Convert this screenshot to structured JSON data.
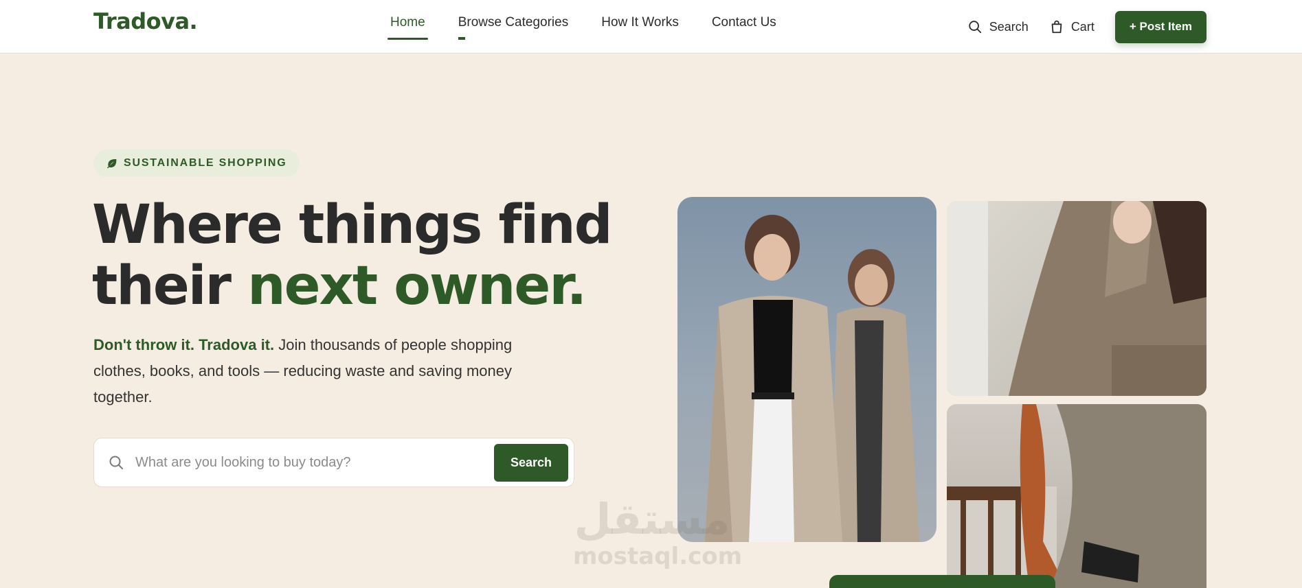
{
  "header": {
    "logo": "Tradova.",
    "nav": [
      {
        "label": "Home",
        "active": true
      },
      {
        "label": "Browse Categories",
        "active": false
      },
      {
        "label": "How It Works",
        "active": false
      },
      {
        "label": "Contact Us",
        "active": false
      }
    ],
    "search_label": "Search",
    "cart_label": "Cart",
    "post_button": "+ Post Item"
  },
  "hero": {
    "badge": "SUSTAINABLE SHOPPING",
    "headline_line1": "Where things find",
    "headline_line2_plain": "their ",
    "headline_line2_accent": "next owner.",
    "subtext_strong": "Don't throw it. Tradova it.",
    "subtext_rest": " Join thousands of people shopping clothes, books, and tools — reducing waste and saving money together.",
    "search_placeholder": "What are you looking to buy today?",
    "search_button": "Search"
  },
  "watermark": {
    "arabic": "مستقل",
    "latin": "mostaql.com"
  },
  "colors": {
    "brand_green": "#2d5a27",
    "page_background": "#f5ede1",
    "badge_background": "#e8eedb"
  },
  "icons": [
    "search-icon",
    "cart-icon",
    "leaf-icon"
  ]
}
